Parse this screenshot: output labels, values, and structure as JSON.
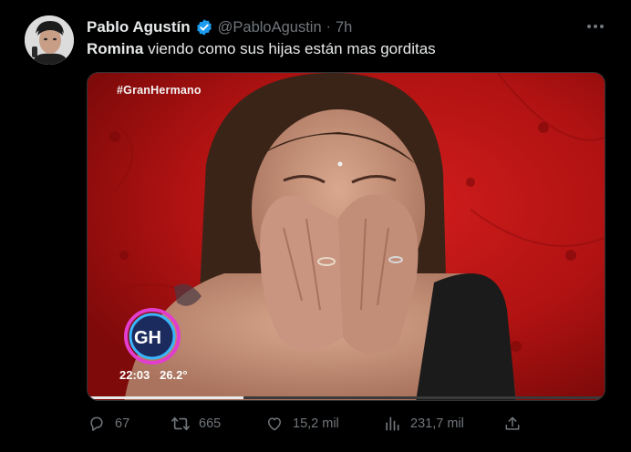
{
  "tweet": {
    "author_name": "Pablo Agustín",
    "handle": "@PabloAgustin",
    "separator": "·",
    "time": "7h",
    "text_bold": "Romina",
    "text_rest": " viendo como sus hijas están mas gorditas"
  },
  "media": {
    "hashtag": "#GranHermano",
    "logo_text": "GH",
    "clock_time": "22:03",
    "temperature": "26.2°",
    "progress": 0.3
  },
  "actions": {
    "replies": "67",
    "retweets": "665",
    "likes": "15,2 mil",
    "views": "231,7 mil"
  },
  "colors": {
    "background": "#000000",
    "text": "#e7e9ea",
    "muted": "#71767b",
    "verified": "#1d9bf0",
    "media_red": "#b51212"
  },
  "icons": [
    "more-icon",
    "verified-badge-icon",
    "reply-icon",
    "retweet-icon",
    "like-icon",
    "views-icon",
    "share-icon"
  ]
}
